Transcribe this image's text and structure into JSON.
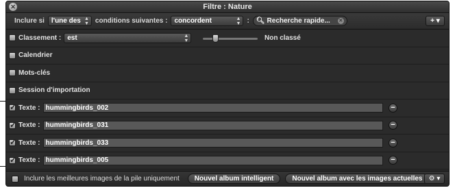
{
  "window": {
    "title": "Filtre : Nature"
  },
  "toolbar": {
    "include_label": "Inclure si",
    "match_value": "l'une des",
    "conditions_label": "conditions suivantes :",
    "operator_value": "concordent",
    "colon": ":",
    "search_placeholder": "Recherche rapide...",
    "add_label": "+ ▾"
  },
  "rating": {
    "label": "Classement :",
    "operator": "est",
    "value_label": "Non classé",
    "checked": false,
    "level": 0
  },
  "criteria": [
    {
      "label": "Calendrier",
      "checked": false
    },
    {
      "label": "Mots-clés",
      "checked": false
    },
    {
      "label": "Session d'importation",
      "checked": false
    }
  ],
  "text_rules": [
    {
      "label": "Texte :",
      "value": "hummingbirds_002",
      "checked": true
    },
    {
      "label": "Texte :",
      "value": "hummingbirds_031",
      "checked": true
    },
    {
      "label": "Texte :",
      "value": "hummingbirds_033",
      "checked": true
    },
    {
      "label": "Texte :",
      "value": "hummingbirds_005",
      "checked": true
    }
  ],
  "bottom": {
    "stack_label": "Inclure les meilleures images de la pile uniquement",
    "smart_album_button": "Nouvel album intelligent",
    "album_current_button": "Nouvel album avec les images actuelles",
    "gear_label": "⚙ ▾"
  }
}
